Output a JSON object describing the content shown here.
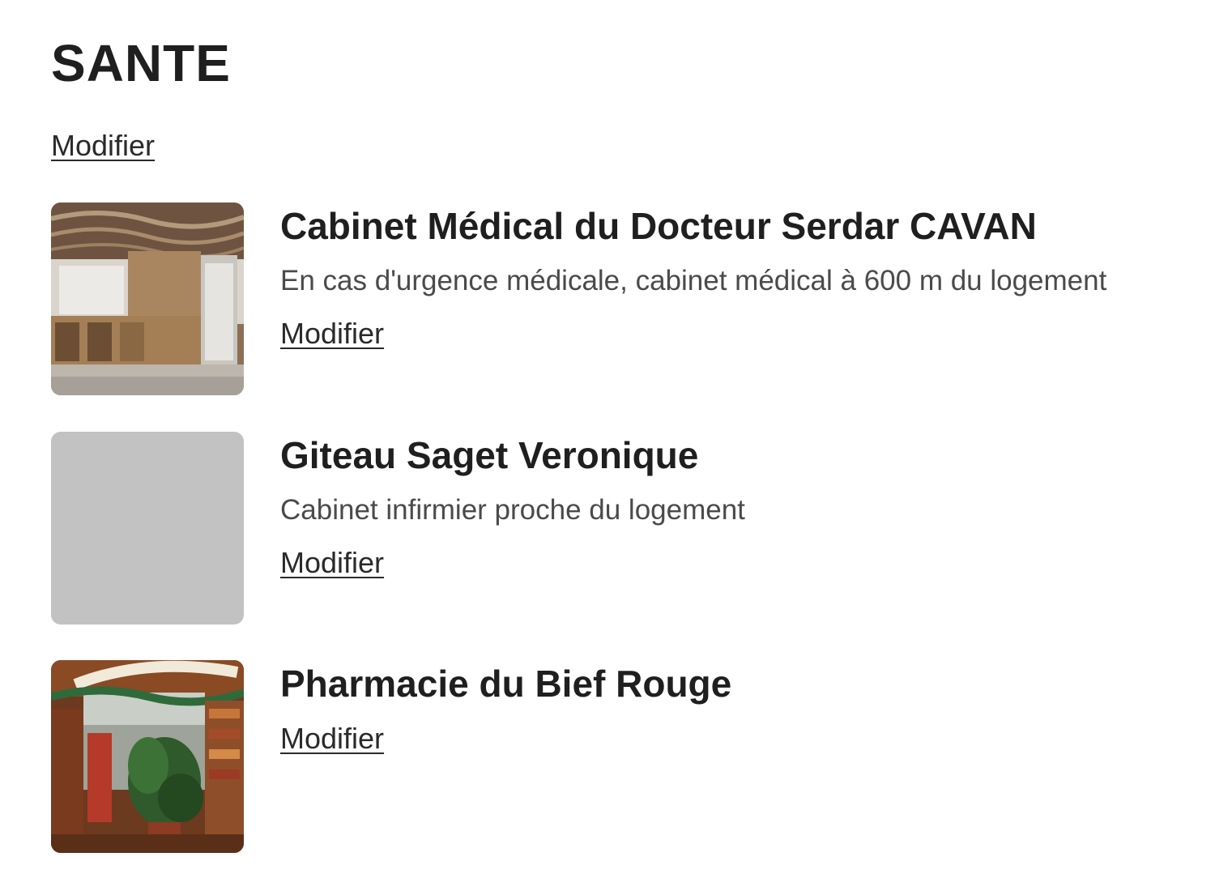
{
  "section": {
    "title": "SANTE",
    "edit_label": "Modifier"
  },
  "items": [
    {
      "title": "Cabinet Médical du Docteur Serdar CAVAN",
      "description": "En cas d'urgence médicale, cabinet médical à 600 m du logement",
      "edit_label": "Modifier",
      "thumbnail": "medical-office-reception-photo"
    },
    {
      "title": "Giteau Saget Veronique",
      "description": "Cabinet infirmier proche du logement",
      "edit_label": "Modifier",
      "thumbnail": "empty-placeholder"
    },
    {
      "title": "Pharmacie du Bief Rouge",
      "edit_label": "Modifier",
      "thumbnail": "pharmacy-storefront-photo"
    }
  ]
}
